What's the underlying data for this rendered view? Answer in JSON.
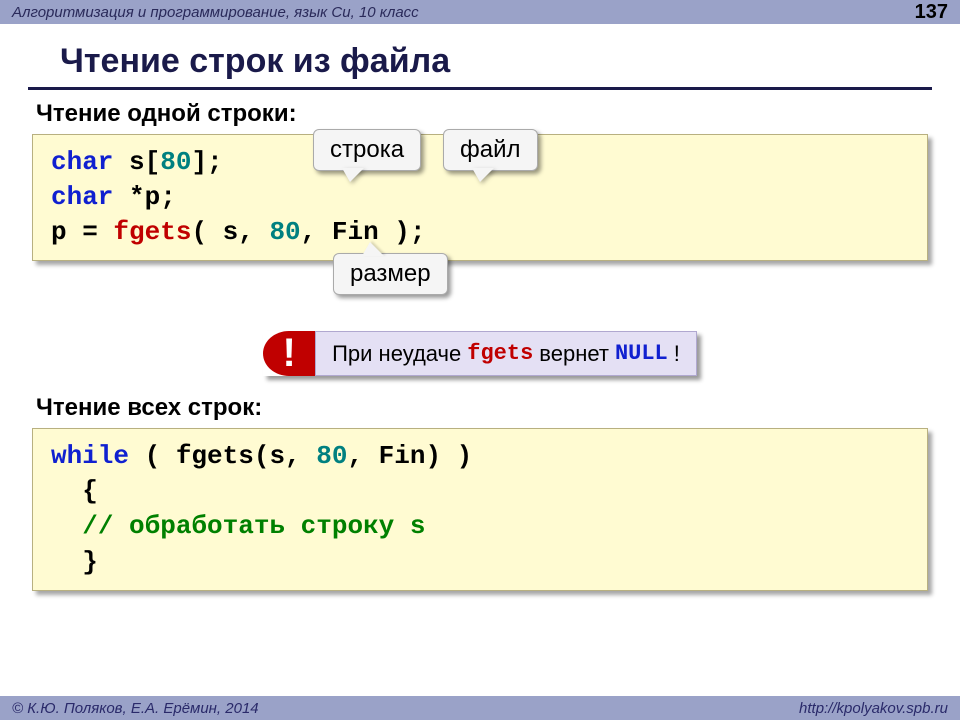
{
  "header": {
    "course": "Алгоритмизация и программирование, язык Си, 10 класс",
    "page": "137"
  },
  "title": "Чтение строк из файла",
  "section1": {
    "label": "Чтение одной строки:",
    "code": {
      "l1a": "char",
      "l1b": " s[",
      "l1c": "80",
      "l1d": "];",
      "l2a": "char",
      "l2b": " *p;",
      "l3a": "p = ",
      "l3b": "fgets",
      "l3c": "( s, ",
      "l3d": "80",
      "l3e": ", Fin );"
    },
    "callout_stroka": "строка",
    "callout_file": "файл",
    "callout_size": "размер"
  },
  "note": {
    "bang": "!",
    "pre": "При неудаче ",
    "fn": "fgets",
    "mid": " вернет ",
    "nul": "NULL",
    "post": "!"
  },
  "section2": {
    "label": "Чтение всех строк:",
    "code": {
      "l1a": "while",
      "l1b": " ( fgets(s, ",
      "l1c": "80",
      "l1d": ", Fin)  )",
      "l2": "  {",
      "l3a": "  ",
      "l3b": "// обработать строку s",
      "l4": "  }"
    }
  },
  "footer": {
    "left": "© К.Ю. Поляков, Е.А. Ерёмин, 2014",
    "right": "http://kpolyakov.spb.ru"
  }
}
